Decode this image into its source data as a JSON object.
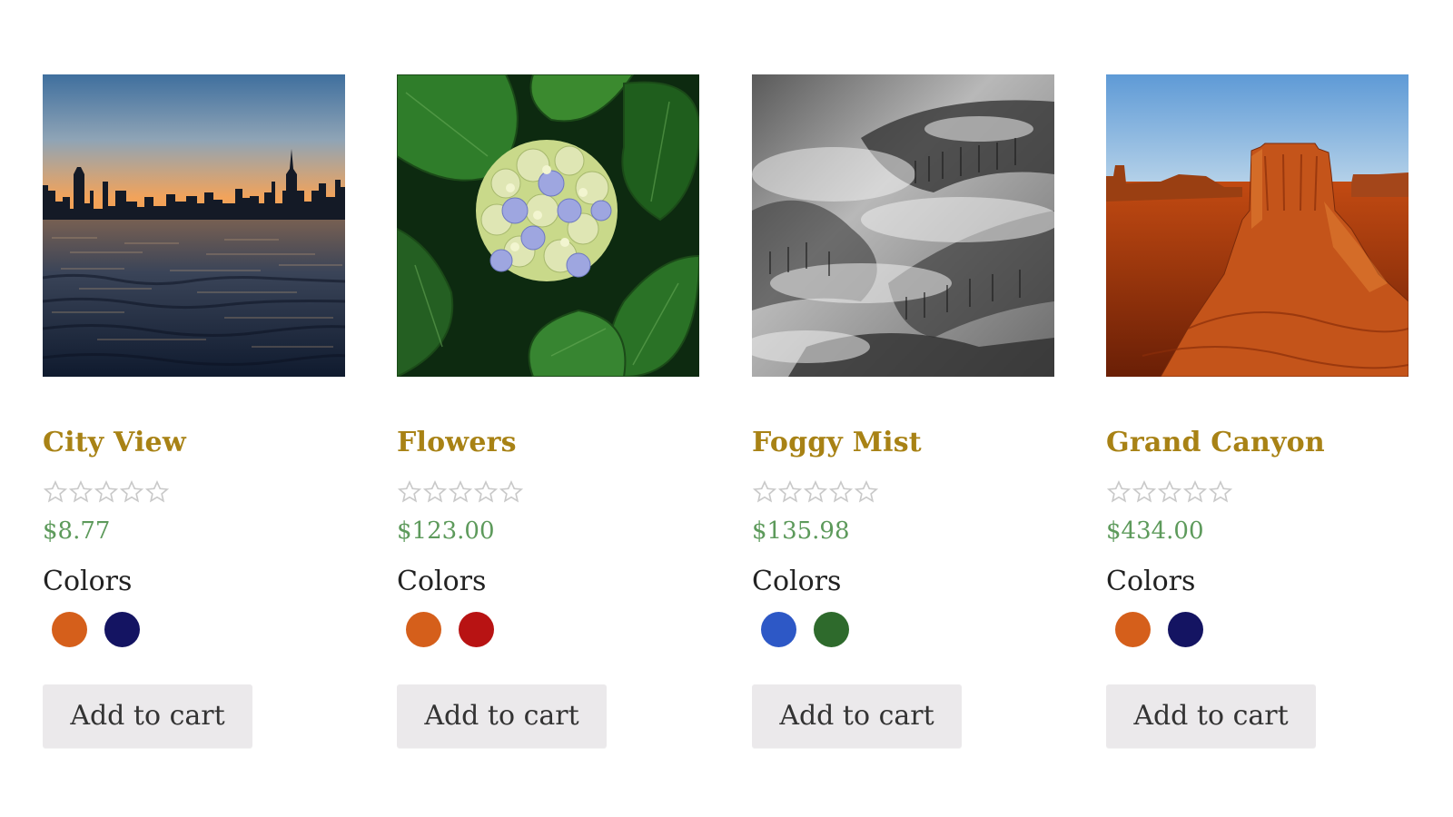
{
  "products": [
    {
      "title": "City View",
      "image": "city-skyline-at-sunset-over-water",
      "rating": 0,
      "price": "$8.77",
      "colors_label": "Colors",
      "swatches": [
        "#d55f1b",
        "#141462"
      ],
      "add_to_cart": "Add to cart"
    },
    {
      "title": "Flowers",
      "image": "blue-and-white-hydrangea-with-green-leaves",
      "rating": 0,
      "price": "$123.00",
      "colors_label": "Colors",
      "swatches": [
        "#d55f1b",
        "#b81313"
      ],
      "add_to_cart": "Add to cart"
    },
    {
      "title": "Foggy Mist",
      "image": "black-and-white-foggy-forest-hills",
      "rating": 0,
      "price": "$135.98",
      "colors_label": "Colors",
      "swatches": [
        "#2d58c6",
        "#2e6a2c"
      ],
      "add_to_cart": "Add to cart"
    },
    {
      "title": "Grand Canyon",
      "image": "red-rock-butte-desert-landscape",
      "rating": 0,
      "price": "$434.00",
      "colors_label": "Colors",
      "swatches": [
        "#d55f1b",
        "#141462"
      ],
      "add_to_cart": "Add to cart"
    }
  ],
  "theme": {
    "title_color": "#a88215",
    "price_color": "#5d9a5b",
    "star_color": "#cccccc",
    "button_bg": "#ebe9eb"
  }
}
